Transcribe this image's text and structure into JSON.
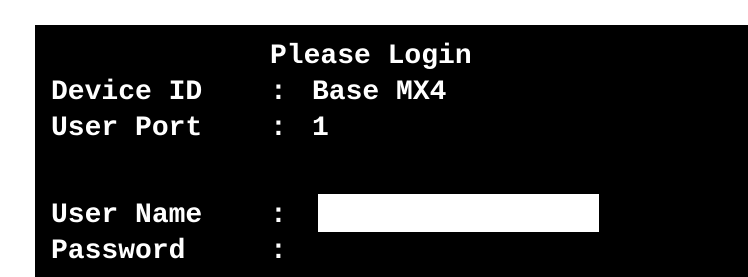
{
  "login": {
    "title": "Please Login",
    "device_id_label": "Device ID",
    "device_id_value": "Base MX4",
    "user_port_label": "User Port",
    "user_port_value": "1",
    "separator": ":",
    "user_name_label": "User Name",
    "user_name_value": "",
    "password_label": "Password",
    "password_value": ""
  },
  "colors": {
    "screen_background": "#000000",
    "text": "#ffffff",
    "active_field": "#ffffff",
    "page_border": "#ffffff"
  }
}
